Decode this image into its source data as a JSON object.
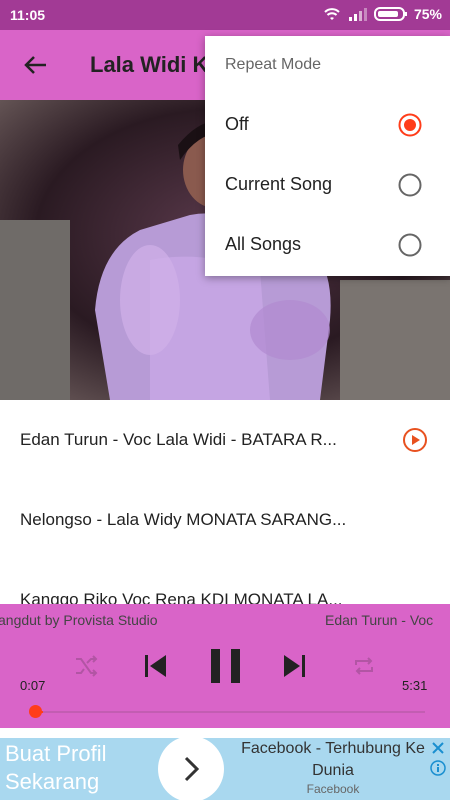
{
  "status": {
    "time": "11:05",
    "battery": "75%"
  },
  "header": {
    "title": "Lala Widi K"
  },
  "songs": [
    {
      "title": "Edan Turun - Voc   Lala Widi - BATARA R..."
    },
    {
      "title": "Nelongso - Lala Widy MONATA SARANG..."
    },
    {
      "title": "Kanggo Riko Voc Rena KDI MONATA LA..."
    }
  ],
  "player": {
    "marquee_left": "angdut by Provista Studio",
    "marquee_right": "Edan Turun - Voc",
    "elapsed": "0:07",
    "duration": "5:31",
    "progress": 0.02
  },
  "ad": {
    "headline": "Buat Profil Sekarang",
    "title": "Facebook - Terhubung Ke Dunia",
    "source": "Facebook"
  },
  "menu": {
    "title": "Repeat Mode",
    "options": [
      {
        "label": "Off",
        "selected": true
      },
      {
        "label": "Current Song",
        "selected": false
      },
      {
        "label": "All Songs",
        "selected": false
      }
    ]
  },
  "colors": {
    "accent": "#ff3d1a",
    "appbar": "#d964c8",
    "statusbar": "#a23a95"
  }
}
